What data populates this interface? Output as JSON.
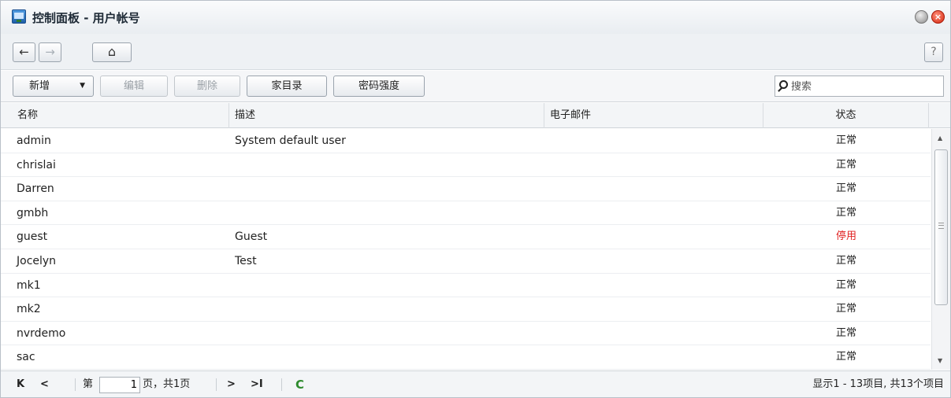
{
  "window": {
    "title": "控制面板 - 用户帐号",
    "icon": "control-panel-icon",
    "close_glyph": "×"
  },
  "nav": {
    "back": "←",
    "forward": "→",
    "home": "⌂",
    "help": "?"
  },
  "toolbar": {
    "add_label": "新增",
    "add_caret": "▼",
    "edit_label": "编辑",
    "delete_label": "删除",
    "home_dir_label": "家目录",
    "password_strength_label": "密码强度"
  },
  "search": {
    "placeholder": "搜索"
  },
  "table": {
    "columns": {
      "name": "名称",
      "description": "描述",
      "email": "电子邮件",
      "status": "状态"
    },
    "rows": [
      {
        "name": "admin",
        "description": "System default user",
        "email": "",
        "status": "正常"
      },
      {
        "name": "chrislai",
        "description": "",
        "email": "",
        "status": "正常"
      },
      {
        "name": "Darren",
        "description": "",
        "email": "",
        "status": "正常"
      },
      {
        "name": "gmbh",
        "description": "",
        "email": "",
        "status": "正常"
      },
      {
        "name": "guest",
        "description": "Guest",
        "email": "",
        "status": "停用"
      },
      {
        "name": "Jocelyn",
        "description": "Test",
        "email": "",
        "status": "正常"
      },
      {
        "name": "mk1",
        "description": "",
        "email": "",
        "status": "正常"
      },
      {
        "name": "mk2",
        "description": "",
        "email": "",
        "status": "正常"
      },
      {
        "name": "nvrdemo",
        "description": "",
        "email": "",
        "status": "正常"
      },
      {
        "name": "sac",
        "description": "",
        "email": "",
        "status": "正常"
      }
    ]
  },
  "scrollbar": {
    "up": "▲",
    "down": "▼"
  },
  "pager": {
    "first": "K",
    "prev": "<",
    "page_prefix": "第",
    "current_page": "1",
    "page_suffix": "页，共1页",
    "next": ">",
    "last": ">I",
    "refresh": "C",
    "summary": "显示1 - 13项目, 共13个项目"
  },
  "colors": {
    "disabled_status": "#e02020",
    "refresh": "#2e8b2e"
  }
}
